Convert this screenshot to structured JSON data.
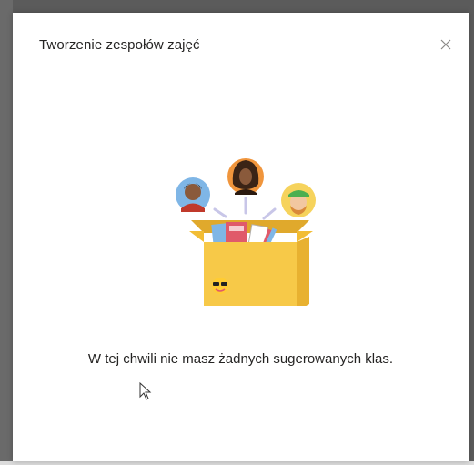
{
  "dialog": {
    "title": "Tworzenie zespołów zajęć",
    "close_icon": "close-icon",
    "empty_state": {
      "message": "W tej chwili nie masz żadnych sugerowanych klas.",
      "illustration": "box-with-avatars-illustration"
    }
  },
  "colors": {
    "title_text": "#252423",
    "box": "#f7c948",
    "avatar_blue": "#7fb6e6",
    "avatar_orange": "#f0953c",
    "avatar_yellow": "#f6d35c"
  }
}
